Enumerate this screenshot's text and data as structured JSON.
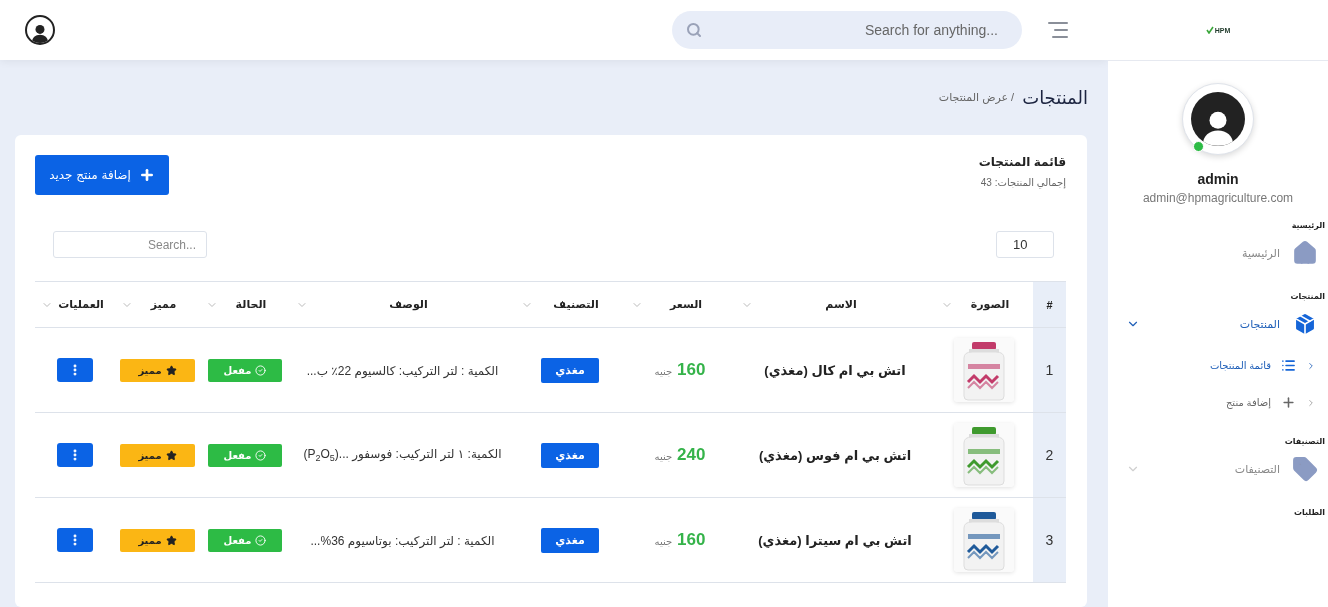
{
  "header": {
    "search": {
      "placeholder": "Search for anything..."
    }
  },
  "page": {
    "title": "المنتجات",
    "breadcrumb": "/ عرض المنتجات"
  },
  "card": {
    "title": "قائمة المنتجات",
    "subtitle": "إجمالي المنتجات: 43",
    "add_button": "إضافة منتج جديد",
    "page_length": "10",
    "search": {
      "placeholder": "Search..."
    }
  },
  "table": {
    "columns": [
      {
        "label": "#",
        "sortable": false
      },
      {
        "label": "الصورة",
        "sortable": true
      },
      {
        "label": "الاسم",
        "sortable": true
      },
      {
        "label": "السعر",
        "sortable": true
      },
      {
        "label": "التصنيف",
        "sortable": true
      },
      {
        "label": "الوصف",
        "sortable": true
      },
      {
        "label": "الحالة",
        "sortable": true
      },
      {
        "label": "مميز",
        "sortable": true
      },
      {
        "label": "العمليات",
        "sortable": true
      }
    ],
    "rows": [
      {
        "index": "1",
        "name": "اتش بي ام كال (مغذي)",
        "price": "160",
        "currency": "جنيه",
        "category": "مغذي",
        "description": "الكمية : لتر التركيب: كالسيوم 22٪ ب...",
        "status": "مفعل",
        "active": true,
        "featured_label": "مميز",
        "featured": true
      },
      {
        "index": "2",
        "name": "اتش بي ام فوس (مغذي)",
        "price": "240",
        "currency": "جنيه",
        "category": "مغذي",
        "description": "الكمية: ١ لتر التركيب: فوسفور (P$_{2}$O$_{5}$)...",
        "status": "مفعل",
        "active": true,
        "featured_label": "مميز",
        "featured": true
      },
      {
        "index": "3",
        "name": "اتش بي ام سيترا (مغذي)",
        "price": "160",
        "currency": "جنيه",
        "category": "مغذي",
        "description": "الكمية : لتر التركيب: بوتاسيوم 36%...",
        "status": "مفعل",
        "active": true,
        "featured_label": "مميز",
        "featured": true
      }
    ]
  },
  "sidebar": {
    "logo": "HPM",
    "user": {
      "name": "admin",
      "email": "admin@hpmagriculture.com",
      "online": true
    },
    "sections": [
      {
        "title": "الرئيسية",
        "items": [
          {
            "label": "الرئيسية",
            "kind": "home",
            "selected": false
          }
        ]
      },
      {
        "title": "المنتجات",
        "items": [
          {
            "label": "المنتجات",
            "kind": "box",
            "selected": true,
            "expanded": true,
            "children": [
              {
                "label": "قائمة المنتجات",
                "kind": "list",
                "selected": true
              },
              {
                "label": "إضافة منتج",
                "kind": "plus",
                "selected": false
              }
            ]
          }
        ]
      },
      {
        "title": "التصنيفات",
        "items": [
          {
            "label": "التصنيفات",
            "kind": "tag",
            "selected": false,
            "expanded": false
          }
        ]
      },
      {
        "title": "الطلبات"
      }
    ]
  }
}
